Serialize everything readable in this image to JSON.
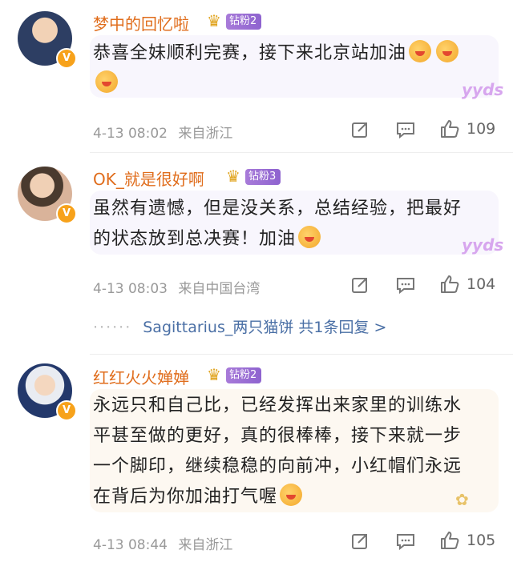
{
  "comments": [
    {
      "username": "梦中的回忆啦",
      "fan_badge": "钻粉2",
      "text_1": "恭喜全妹顺利完赛，接下来北京站加油",
      "text_2": "",
      "text_3": "",
      "text_4": "",
      "time": "4-13 08:02",
      "source": "来自浙江",
      "likes": "109"
    },
    {
      "username": "OK_就是很好啊",
      "fan_badge": "钻粉3",
      "text_1": "虽然有遗憾，但是没关系，总结经验，把最好",
      "text_2": "的状态放到总决赛！加油",
      "time": "4-13 08:03",
      "source": "来自中国台湾",
      "likes": "104",
      "reply_summary": "Sagittarius_两只猫饼  共1条回复 >"
    },
    {
      "username": "红红火火婵婵",
      "fan_badge": "钻粉2",
      "text_1": "永远只和自己比，已经发挥出来家里的训练水",
      "text_2": "平甚至做的更好，真的很棒棒，接下来就一步",
      "text_3": "一个脚印，继续稳稳的向前冲，小红帽们永远",
      "text_4": "在背后为你加油打气喔",
      "time": "4-13 08:44",
      "source": "来自浙江",
      "likes": "105"
    }
  ],
  "colors": {
    "username": "#e06d1c",
    "fan_badge": "#9b6fd6",
    "reply_link": "#4a6fa5",
    "meta": "#999999"
  },
  "icons": {
    "verified": "v-badge-icon",
    "crown": "crown-icon",
    "share": "share-icon",
    "comment": "comment-icon",
    "like": "thumbs-up-icon"
  }
}
